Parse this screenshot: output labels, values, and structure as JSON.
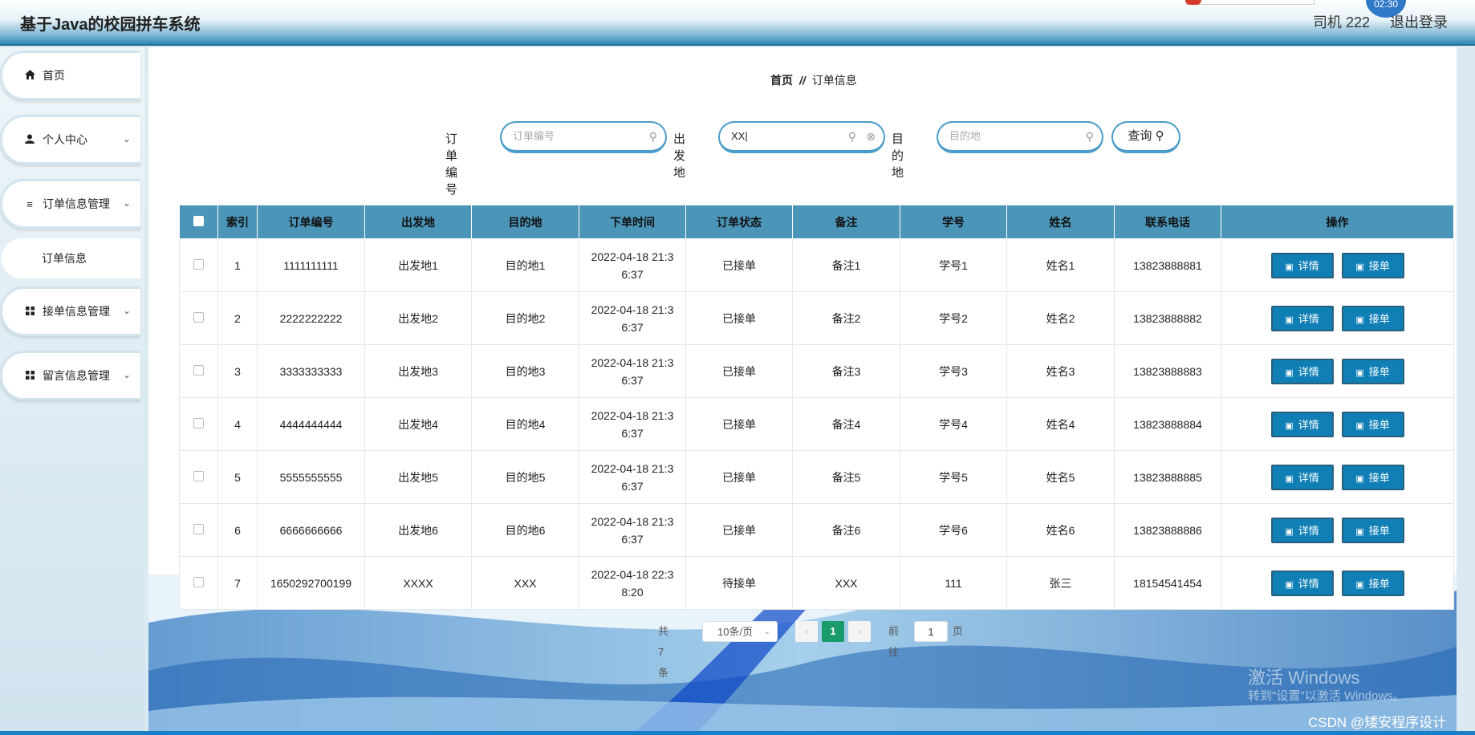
{
  "app": {
    "title": "基于Java的校园拼车系统"
  },
  "top": {
    "user": "司机 222",
    "logout": "退出登录",
    "clock": "02:30"
  },
  "sidebar": {
    "items": [
      {
        "label": "首页",
        "icon": "home-icon"
      },
      {
        "label": "个人中心",
        "icon": "user-icon"
      },
      {
        "label": "订单信息管理",
        "icon": "list-icon"
      },
      {
        "label": "订单信息",
        "icon": ""
      },
      {
        "label": "接单信息管理",
        "icon": "grid-icon"
      },
      {
        "label": "留言信息管理",
        "icon": "grid-icon"
      }
    ]
  },
  "breadcrumb": {
    "home": "首页",
    "sep": "//",
    "current": "订单信息"
  },
  "search": {
    "order_no_label": "订单编号",
    "order_no_placeholder": "订单编号",
    "origin_label": "出发地",
    "origin_value": "XX",
    "dest_label": "目的地",
    "dest_placeholder": "目的地",
    "query_label": "查询"
  },
  "table": {
    "headers": [
      "索引",
      "订单编号",
      "出发地",
      "目的地",
      "下单时间",
      "订单状态",
      "备注",
      "学号",
      "姓名",
      "联系电话",
      "操作"
    ],
    "detail_label": "详情",
    "accept_label": "接单",
    "rows": [
      [
        "1",
        "1111111111",
        "出发地1",
        "目的地1",
        "2022-04-18 21:3",
        "6:37",
        "已接单",
        "备注1",
        "学号1",
        "姓名1",
        "13823888881"
      ],
      [
        "2",
        "2222222222",
        "出发地2",
        "目的地2",
        "2022-04-18 21:3",
        "6:37",
        "已接单",
        "备注2",
        "学号2",
        "姓名2",
        "13823888882"
      ],
      [
        "3",
        "3333333333",
        "出发地3",
        "目的地3",
        "2022-04-18 21:3",
        "6:37",
        "已接单",
        "备注3",
        "学号3",
        "姓名3",
        "13823888883"
      ],
      [
        "4",
        "4444444444",
        "出发地4",
        "目的地4",
        "2022-04-18 21:3",
        "6:37",
        "已接单",
        "备注4",
        "学号4",
        "姓名4",
        "13823888884"
      ],
      [
        "5",
        "5555555555",
        "出发地5",
        "目的地5",
        "2022-04-18 21:3",
        "6:37",
        "已接单",
        "备注5",
        "学号5",
        "姓名5",
        "13823888885"
      ],
      [
        "6",
        "6666666666",
        "出发地6",
        "目的地6",
        "2022-04-18 21:3",
        "6:37",
        "已接单",
        "备注6",
        "学号6",
        "姓名6",
        "13823888886"
      ],
      [
        "7",
        "1650292700199",
        "XXXX",
        "XXX",
        "2022-04-18 22:3",
        "8:20",
        "待接单",
        "XXX",
        "111",
        "张三",
        "18154541454"
      ]
    ]
  },
  "pager": {
    "total": "共 7 条",
    "page_size": "10条/页",
    "current": "1",
    "goto_label": "前往",
    "goto_value": "1",
    "page_unit": "页"
  },
  "overlay": {
    "activate": "激活 Windows",
    "activate_hint": "转到\"设置\"以激活 Windows。",
    "csdn": "CSDN @矮安程序设计"
  },
  "colors": {
    "accent": "#4a95b8",
    "button": "#0f7fb5",
    "pager_active": "#1a9b6c"
  }
}
